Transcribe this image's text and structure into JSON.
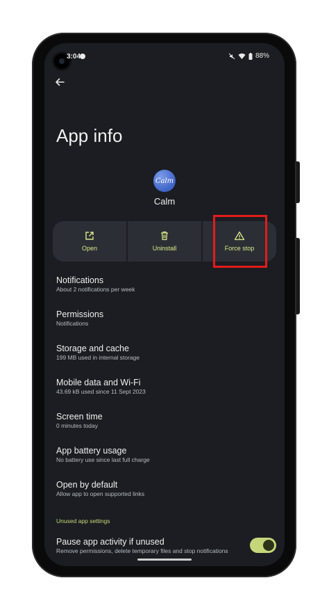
{
  "status_bar": {
    "time": "3:04",
    "battery": "88%"
  },
  "header": {
    "title": "App info"
  },
  "app": {
    "name": "Calm",
    "icon_text": "Calm"
  },
  "actions": [
    {
      "label": "Open",
      "icon": "open-external-icon"
    },
    {
      "label": "Uninstall",
      "icon": "trash-icon"
    },
    {
      "label": "Force stop",
      "icon": "warning-icon"
    }
  ],
  "settings": [
    {
      "title": "Notifications",
      "subtitle": "About 2 notifications per week"
    },
    {
      "title": "Permissions",
      "subtitle": "Notifications"
    },
    {
      "title": "Storage and cache",
      "subtitle": "199 MB used in internal storage"
    },
    {
      "title": "Mobile data and Wi-Fi",
      "subtitle": "43.69 kB used since 11 Sept 2023"
    },
    {
      "title": "Screen time",
      "subtitle": "0 minutes today"
    },
    {
      "title": "App battery usage",
      "subtitle": "No battery use since last full charge"
    },
    {
      "title": "Open by default",
      "subtitle": "Allow app to open supported links"
    }
  ],
  "unused_section": {
    "heading": "Unused app settings",
    "pause_title": "Pause app activity if unused",
    "pause_subtitle": "Remove permissions, delete temporary files and stop notifications",
    "pause_enabled": true
  },
  "colors": {
    "accent": "#d9e98a",
    "highlight": "#e41b1b",
    "screen_bg": "#1b1d22"
  }
}
